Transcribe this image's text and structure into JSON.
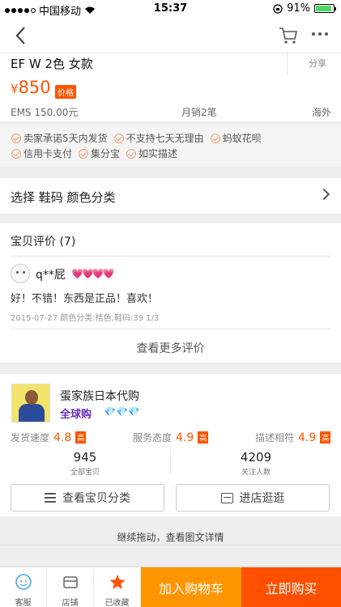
{
  "status_bar": {
    "carrier": "中国移动",
    "time": "15:37",
    "battery": "91%",
    "battery_level": 0.91
  },
  "product": {
    "title": "EF W  2色 女款",
    "share_label": "分享",
    "currency": "¥",
    "price": "850",
    "price_tag": "价格",
    "shipping": "EMS 150.00元",
    "monthly_sales": "月销2笔",
    "origin": "海外"
  },
  "services": {
    "row1": [
      "卖家承诺5天内发货",
      "不支持七天无理由",
      "蚂蚁花呗"
    ],
    "row2": [
      "信用卡支付",
      "集分宝",
      "如实描述"
    ]
  },
  "sku": {
    "label": "选择 鞋码 颜色分类"
  },
  "reviews": {
    "title": "宝贝评价 (7)",
    "user": "q**屁",
    "hearts": "💗💗💗💗",
    "text": "好！不错！东西是正品！喜欢！",
    "meta": "2015-07-27 颜色分类:桔色;鞋码:39 1/3",
    "more": "查看更多评价"
  },
  "shop": {
    "name": "蛋家族日本代购",
    "badge": "全球购",
    "diamonds": "💎💎💎",
    "scores": [
      {
        "label": "发货速度",
        "value": "4.8",
        "tag": "高"
      },
      {
        "label": "服务态度",
        "value": "4.9",
        "tag": "高"
      },
      {
        "label": "描述相符",
        "value": "4.9",
        "tag": "高"
      }
    ],
    "items_count": "945",
    "items_label": "全部宝贝",
    "followers_count": "4209",
    "followers_label": "关注人数",
    "btn_categories": "查看宝贝分类",
    "btn_enter": "进店逛逛"
  },
  "detail_hint": "继续拖动，查看图文详情",
  "bottom": {
    "service": "客服",
    "store": "店铺",
    "collected": "已收藏",
    "add_cart": "加入购物车",
    "buy_now": "立即购买"
  },
  "colors": {
    "accent": "#ff5000",
    "cart": "#ff9500"
  }
}
